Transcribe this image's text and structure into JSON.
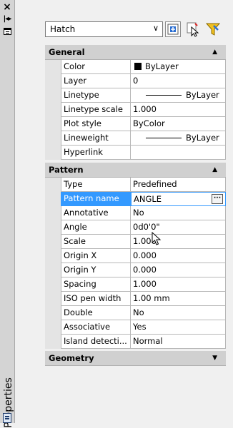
{
  "side": {
    "title": "Properties"
  },
  "header": {
    "selected_object": "Hatch"
  },
  "sections": {
    "general": {
      "title": "General",
      "rows": [
        {
          "name": "Color",
          "value": "ByLayer"
        },
        {
          "name": "Layer",
          "value": "0"
        },
        {
          "name": "Linetype",
          "value": "ByLayer"
        },
        {
          "name": "Linetype scale",
          "value": "1.000"
        },
        {
          "name": "Plot style",
          "value": "ByColor"
        },
        {
          "name": "Lineweight",
          "value": "ByLayer"
        },
        {
          "name": "Hyperlink",
          "value": ""
        }
      ]
    },
    "pattern": {
      "title": "Pattern",
      "rows": [
        {
          "name": "Type",
          "value": "Predefined"
        },
        {
          "name": "Pattern name",
          "value": "ANGLE"
        },
        {
          "name": "Annotative",
          "value": "No"
        },
        {
          "name": "Angle",
          "value": "0d0'0\""
        },
        {
          "name": "Scale",
          "value": "1.000"
        },
        {
          "name": "Origin X",
          "value": "0.000"
        },
        {
          "name": "Origin Y",
          "value": "0.000"
        },
        {
          "name": "Spacing",
          "value": "1.000"
        },
        {
          "name": "ISO pen width",
          "value": "1.00 mm"
        },
        {
          "name": "Double",
          "value": "No"
        },
        {
          "name": "Associative",
          "value": "Yes"
        },
        {
          "name": "Island detecti...",
          "value": "Normal"
        }
      ]
    },
    "geometry": {
      "title": "Geometry"
    }
  },
  "icons": [
    "close-icon",
    "autohide-icon",
    "properties-menu-icon",
    "quick-select-icon",
    "select-objects-icon",
    "toggle-pickadd-icon",
    "ellipsis-icon",
    "mouse-cursor-icon",
    "color-swatch-icon"
  ]
}
